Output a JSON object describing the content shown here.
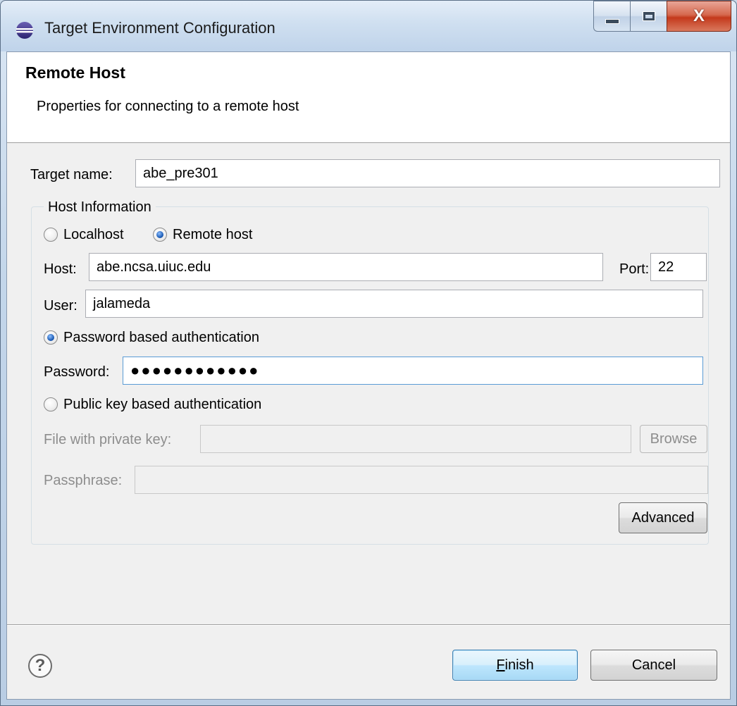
{
  "window": {
    "title": "Target Environment Configuration",
    "close_glyph": "X",
    "icons": {
      "app": "eclipse-icon",
      "minimize": "minimize-icon",
      "maximize": "maximize-icon",
      "close": "close-icon"
    }
  },
  "header": {
    "title": "Remote Host",
    "description": "Properties for connecting to a remote host"
  },
  "form": {
    "target_name": {
      "label": "Target name:",
      "value": "abe_pre301"
    },
    "host_info": {
      "legend": "Host Information",
      "localhost_label": "Localhost",
      "remotehost_label": "Remote host",
      "selected": "Remote host",
      "host": {
        "label": "Host:",
        "value": "abe.ncsa.uiuc.edu"
      },
      "port": {
        "label": "Port:",
        "value": "22"
      },
      "user": {
        "label": "User:",
        "value": "jalameda"
      },
      "password_auth_label": "Password based authentication",
      "password": {
        "label": "Password:",
        "masked_value": "●●●●●●●●●●●●"
      },
      "pubkey_auth_label": "Public key based authentication",
      "private_key_file": {
        "label": "File with private key:",
        "value": ""
      },
      "browse_label": "Browse",
      "passphrase": {
        "label": "Passphrase:",
        "value": ""
      },
      "advanced_label": "Advanced"
    }
  },
  "footer": {
    "help_glyph": "?",
    "finish_mnemonic": "F",
    "finish_rest": "inish",
    "cancel_label": "Cancel"
  },
  "colors": {
    "default_button_border": "#3c7fb1",
    "focus_border": "#5a9bd5",
    "radio_selected": "#1f5fb8",
    "close_button": "#c4391c"
  }
}
